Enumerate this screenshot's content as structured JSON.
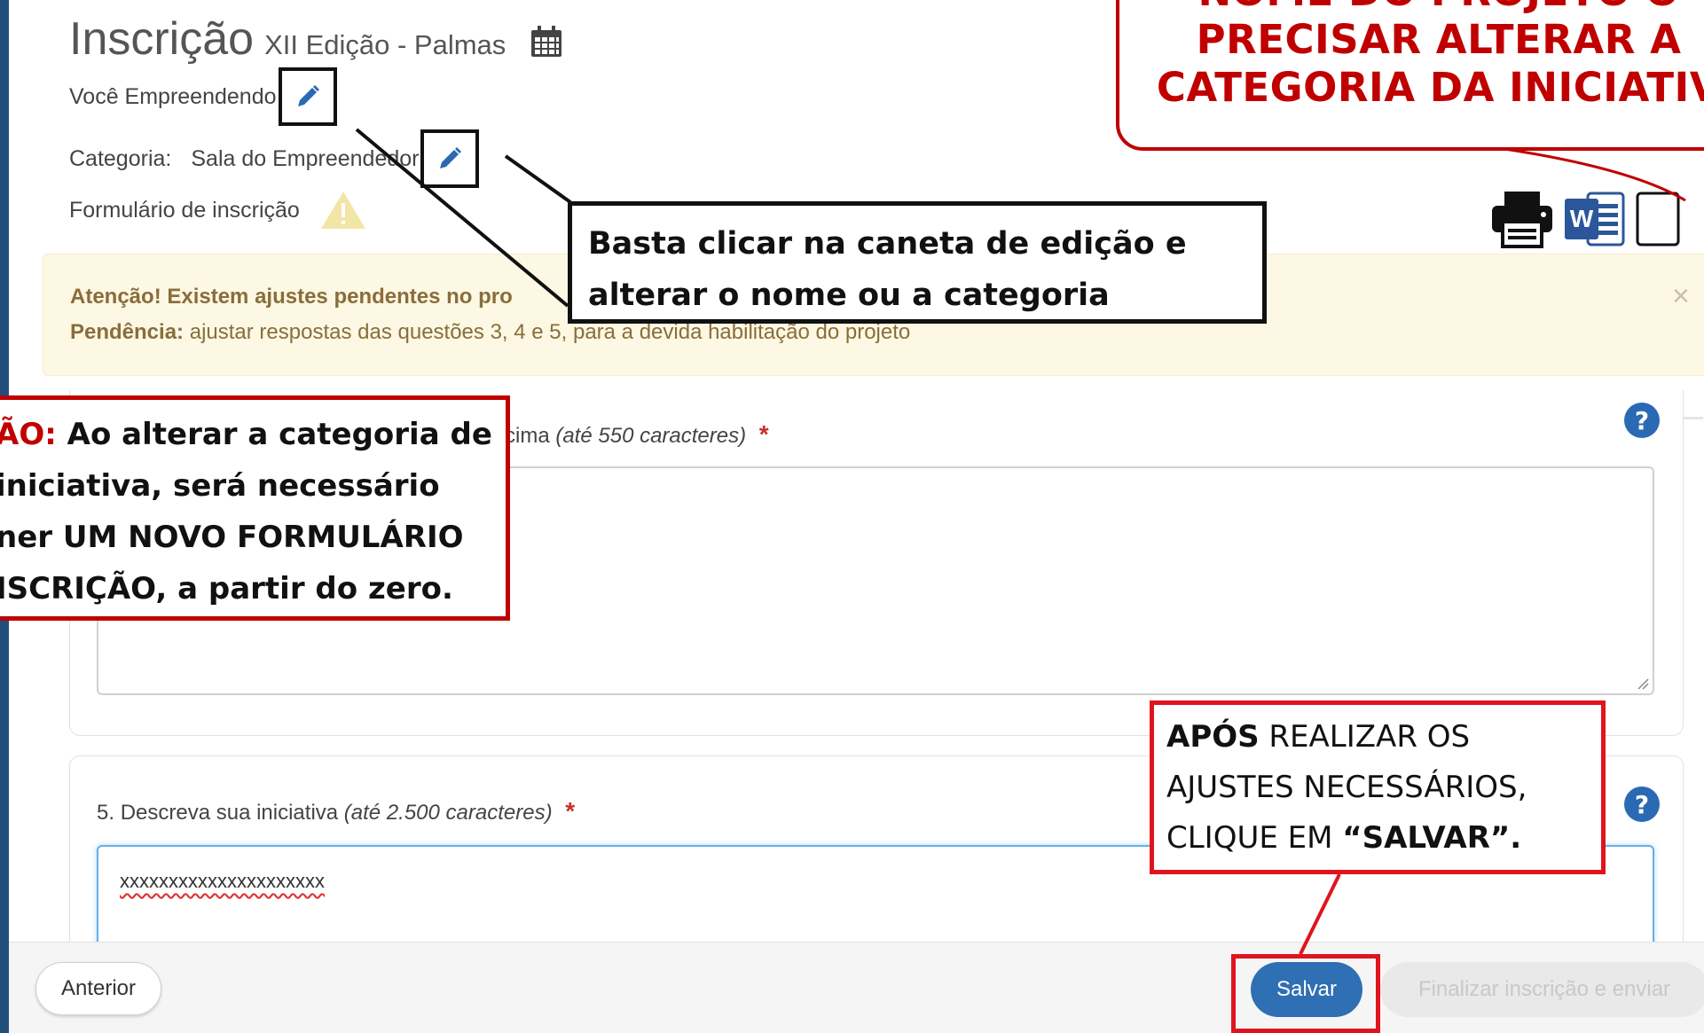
{
  "header": {
    "title": "Inscrição",
    "subtitle": "XII Edição - Palmas",
    "calendar_icon": "calendar-icon"
  },
  "project": {
    "name": "Você Empreendendo",
    "category_label": "Categoria:",
    "category_value": "Sala do Empreendedor",
    "form_label": "Formulário de inscrição",
    "edit_icon": "pencil-icon",
    "warning_icon": "warning-triangle-icon"
  },
  "doc_actions": {
    "print_icon": "printer-icon",
    "word_icon": "word-icon",
    "pdf_icon": "document-icon"
  },
  "alert": {
    "line1": "Atenção! Existem ajustes pendentes no pro",
    "line2_prefix": "Pendência:",
    "line2_text": " ajustar respostas das questões 3, 4 e 5, para a devida habilitação do projeto",
    "close": "×"
  },
  "questions": [
    {
      "label_tail": "cima",
      "hint": "(até 550 caracteres)",
      "required": "*",
      "help": "?"
    },
    {
      "number": "5.",
      "label": "Descreva sua iniciativa",
      "hint": "(até 2.500 caracteres)",
      "required": "*",
      "answer": "xxxxxxxxxxxxxxxxxxxxx",
      "help": "?"
    }
  ],
  "footer": {
    "prev": "Anterior",
    "save": "Salvar",
    "finalize": "Finalizar inscrição e enviar"
  },
  "annotations": {
    "bubble_lines": [
      "NOME DO PROJETO O",
      "PRECISAR ALTERAR A",
      "CATEGORIA DA INICIATIV"
    ],
    "black_callout": [
      "Basta clicar na caneta de edição e",
      "alterar o nome ou a  categoria"
    ],
    "left_callout_red_prefix": "ÃO:",
    "left_callout_lines": [
      " Ao alterar a categoria de",
      " iniciativa, será necessário",
      "ner UM NOVO FORMULÁRIO",
      "ISCRIÇÃO,  a partir do zero."
    ],
    "right_callout_bold": "APÓS",
    "right_callout_line1": " REALIZAR OS",
    "right_callout_line2": "AJUSTES NECESSÁRIOS,",
    "right_callout_line3_prefix": "CLIQUE EM  ",
    "right_callout_line3_bold": "“SALVAR”."
  },
  "colors": {
    "brand_blue": "#2f6fb3",
    "annotation_red": "#c00000",
    "alert_bg": "#fcf8e3",
    "alert_text": "#8a6d3b"
  }
}
